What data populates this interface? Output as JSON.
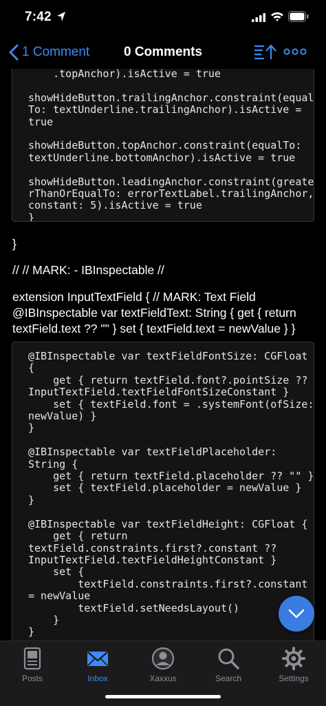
{
  "status": {
    "time": "7:42"
  },
  "nav": {
    "back_label": "1 Comment",
    "title": "0 Comments"
  },
  "content": {
    "code_block_1": "    .topAnchor).isActive = true\n\nshowHideButton.trailingAnchor.constraint(equal\nTo: textUnderline.trailingAnchor).isActive =\ntrue\n\nshowHideButton.topAnchor.constraint(equalTo:\ntextUnderline.bottomAnchor).isActive = true\n\nshowHideButton.leadingAnchor.constraint(greate\nrThanOrEqualTo: errorTextLabel.trailingAnchor,\nconstant: 5).isActive = true\n}",
    "closing_brace": "}",
    "mark_line": "// // MARK: - IBInspectable //",
    "extension_text": "extension InputTextField { // MARK: Text Field @IBInspectable var textFieldText: String { get { return textField.text ?? \"\" } set { textField.text = newValue } }",
    "code_block_2": "@IBInspectable var textFieldFontSize: CGFloat\n{\n    get { return textField.font?.pointSize ??\nInputTextField.textFieldFontSizeConstant }\n    set { textField.font = .systemFont(ofSize:\nnewValue) }\n}\n\n@IBInspectable var textFieldPlaceholder:\nString {\n    get { return textField.placeholder ?? \"\" }\n    set { textField.placeholder = newValue }\n}\n\n@IBInspectable var textFieldHeight: CGFloat {\n    get { return\ntextField.constraints.first?.constant ??\nInputTextField.textFieldHeightConstant }\n    set {\n        textField.constraints.first?.constant\n= newValue\n        textField.setNeedsLayout()\n    }\n}"
  },
  "tabs": [
    {
      "label": "Posts",
      "icon": "posts-icon",
      "active": false
    },
    {
      "label": "Inbox",
      "icon": "inbox-icon",
      "active": true
    },
    {
      "label": "Xaxxus",
      "icon": "profile-icon",
      "active": false
    },
    {
      "label": "Search",
      "icon": "search-icon",
      "active": false
    },
    {
      "label": "Settings",
      "icon": "gear-icon",
      "active": false
    }
  ],
  "colors": {
    "accent": "#3d8af7",
    "background": "#000000",
    "code_background": "#141414",
    "tab_bar": "#1b1b1d",
    "fab": "#3a7ce0"
  }
}
